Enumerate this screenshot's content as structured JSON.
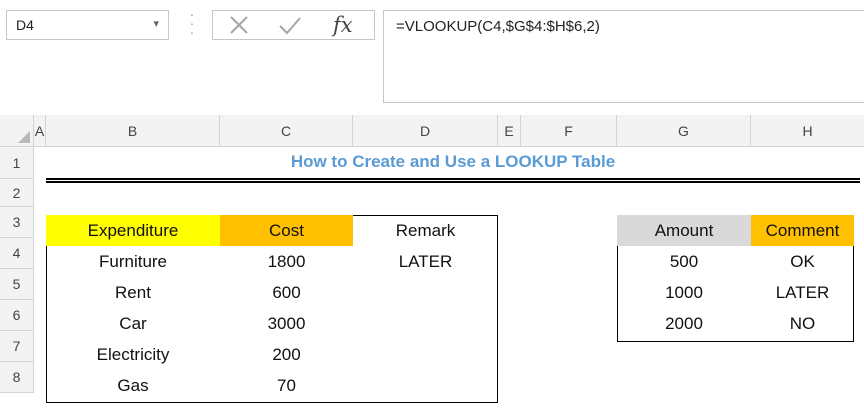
{
  "formula_bar": {
    "name_box": "D4",
    "name_box_arrow": "▾",
    "separator": "⋮",
    "cancel_glyph": "✕",
    "enter_glyph": "✓",
    "fx_glyph": "fx",
    "formula": "=VLOOKUP(C4,$G$4:$H$6,2)"
  },
  "columns": [
    "A",
    "B",
    "C",
    "D",
    "E",
    "F",
    "G",
    "H"
  ],
  "rows": [
    "1",
    "2",
    "3",
    "4",
    "5",
    "6",
    "7",
    "8"
  ],
  "sheet": {
    "title": "How to Create and Use a LOOKUP Table",
    "left_table": {
      "headers": [
        "Expenditure",
        "Cost",
        "Remark"
      ],
      "rows": [
        [
          "Furniture",
          "1800",
          "LATER"
        ],
        [
          "Rent",
          "600",
          ""
        ],
        [
          "Car",
          "3000",
          ""
        ],
        [
          "Electricity",
          "200",
          ""
        ],
        [
          "Gas",
          "70",
          ""
        ]
      ]
    },
    "right_table": {
      "headers": [
        "Amount",
        "Comment"
      ],
      "rows": [
        [
          "500",
          "OK"
        ],
        [
          "1000",
          "LATER"
        ],
        [
          "2000",
          "NO"
        ]
      ]
    }
  },
  "colors": {
    "title_blue": "#5b9bd5",
    "expenditure_header": "#ffff00",
    "cost_header": "#ffc000",
    "amount_header": "#d9d9d9",
    "comment_header": "#ffc000"
  }
}
